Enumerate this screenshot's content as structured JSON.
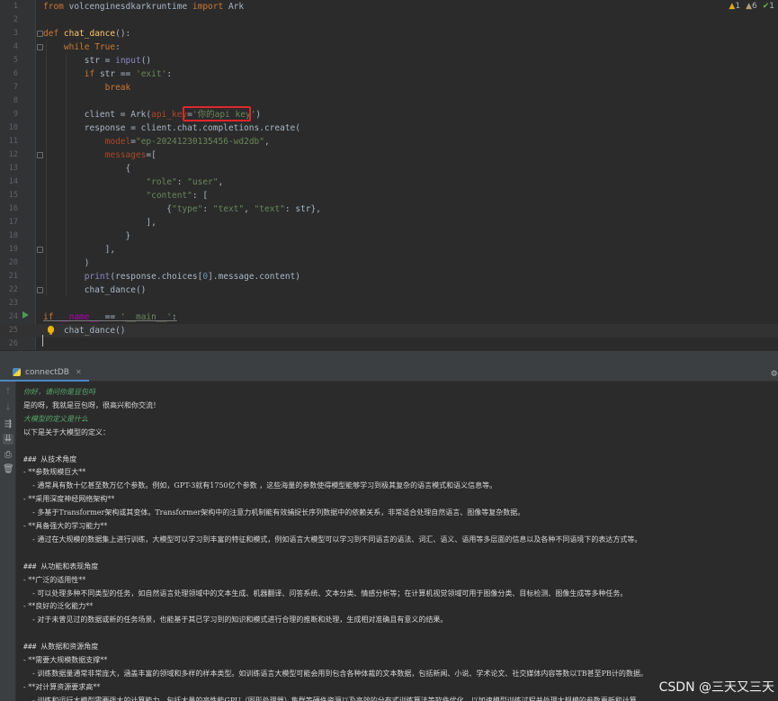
{
  "editor": {
    "inspections": {
      "warnings": "1",
      "weak_warnings": "6",
      "ok": "1"
    },
    "lines": [
      {
        "n": "1",
        "tokens": [
          [
            "kw",
            "from "
          ],
          [
            "plain",
            "volcenginesdkarkruntime "
          ],
          [
            "kw",
            "import "
          ],
          [
            "plain",
            "Ark"
          ]
        ]
      },
      {
        "n": "2",
        "tokens": []
      },
      {
        "n": "3",
        "tokens": [
          [
            "kw",
            "def "
          ],
          [
            "fn",
            "chat_dance"
          ],
          [
            "plain",
            "():"
          ]
        ]
      },
      {
        "n": "4",
        "tokens": [
          [
            "plain",
            "    "
          ],
          [
            "kw",
            "while "
          ],
          [
            "kw",
            "True"
          ],
          [
            "plain",
            ":"
          ]
        ]
      },
      {
        "n": "5",
        "tokens": [
          [
            "plain",
            "        "
          ],
          [
            "plain",
            "str = "
          ],
          [
            "builtin",
            "input"
          ],
          [
            "plain",
            "()"
          ]
        ]
      },
      {
        "n": "6",
        "tokens": [
          [
            "plain",
            "        "
          ],
          [
            "kw",
            "if "
          ],
          [
            "plain",
            "str == "
          ],
          [
            "str",
            "'exit'"
          ],
          [
            "plain",
            ":"
          ]
        ]
      },
      {
        "n": "7",
        "tokens": [
          [
            "plain",
            "            "
          ],
          [
            "kw",
            "break"
          ]
        ]
      },
      {
        "n": "8",
        "tokens": []
      },
      {
        "n": "9",
        "tokens": [
          [
            "plain",
            "        client = Ark("
          ],
          [
            "param",
            "api_key"
          ],
          [
            "plain",
            "="
          ],
          [
            "str",
            "'你的api key'"
          ],
          [
            "plain",
            ")"
          ]
        ]
      },
      {
        "n": "10",
        "tokens": [
          [
            "plain",
            "        response = client.chat.completions.create("
          ]
        ]
      },
      {
        "n": "11",
        "tokens": [
          [
            "plain",
            "            "
          ],
          [
            "param",
            "model"
          ],
          [
            "plain",
            "="
          ],
          [
            "str",
            "\"ep-20241230135456-wd2db\""
          ],
          [
            "plain",
            ","
          ]
        ]
      },
      {
        "n": "12",
        "tokens": [
          [
            "plain",
            "            "
          ],
          [
            "param",
            "messages"
          ],
          [
            "plain",
            "=["
          ]
        ]
      },
      {
        "n": "13",
        "tokens": [
          [
            "plain",
            "                {"
          ]
        ]
      },
      {
        "n": "14",
        "tokens": [
          [
            "plain",
            "                    "
          ],
          [
            "str",
            "\"role\""
          ],
          [
            "plain",
            ": "
          ],
          [
            "str",
            "\"user\""
          ],
          [
            "plain",
            ","
          ]
        ]
      },
      {
        "n": "15",
        "tokens": [
          [
            "plain",
            "                    "
          ],
          [
            "str",
            "\"content\""
          ],
          [
            "plain",
            ": ["
          ]
        ]
      },
      {
        "n": "16",
        "tokens": [
          [
            "plain",
            "                        {"
          ],
          [
            "str",
            "\"type\""
          ],
          [
            "plain",
            ": "
          ],
          [
            "str",
            "\"text\""
          ],
          [
            "plain",
            ", "
          ],
          [
            "str",
            "\"text\""
          ],
          [
            "plain",
            ": str},"
          ]
        ]
      },
      {
        "n": "17",
        "tokens": [
          [
            "plain",
            "                    ],"
          ]
        ]
      },
      {
        "n": "18",
        "tokens": [
          [
            "plain",
            "                }"
          ]
        ]
      },
      {
        "n": "19",
        "tokens": [
          [
            "plain",
            "            ],"
          ]
        ]
      },
      {
        "n": "20",
        "tokens": [
          [
            "plain",
            "        )"
          ]
        ]
      },
      {
        "n": "21",
        "tokens": [
          [
            "plain",
            "        "
          ],
          [
            "builtin",
            "print"
          ],
          [
            "plain",
            "(response.choices["
          ],
          [
            "num",
            "0"
          ],
          [
            "plain",
            "].message.content)"
          ]
        ]
      },
      {
        "n": "22",
        "tokens": [
          [
            "plain",
            "        chat_dance()"
          ]
        ]
      },
      {
        "n": "23",
        "tokens": []
      },
      {
        "n": "24",
        "tokens": [
          [
            "kw",
            "if "
          ],
          [
            "dunder",
            "__name__"
          ],
          [
            "plain",
            " == "
          ],
          [
            "str",
            "'__main__'"
          ],
          [
            "plain",
            ":"
          ]
        ]
      },
      {
        "n": "25",
        "tokens": [
          [
            "plain",
            "    chat_dance()"
          ]
        ]
      },
      {
        "n": "26",
        "tokens": []
      }
    ]
  },
  "run_panel": {
    "tab_label": "connectDB",
    "console_lines": [
      {
        "style": "green",
        "text": "你好，请问你是豆包吗"
      },
      {
        "style": "normal",
        "text": "是的呀，我就是豆包呀，很高兴和你交流！"
      },
      {
        "style": "green",
        "text": "大模型的定义是什么"
      },
      {
        "style": "normal",
        "text": "以下是关于大模型的定义："
      },
      {
        "style": "normal",
        "text": ""
      },
      {
        "style": "heading",
        "text": "### 从技术角度"
      },
      {
        "style": "normal",
        "text": "- **参数规模巨大**"
      },
      {
        "style": "normal",
        "text": "    - 通常具有数十亿甚至数万亿个参数。例如，GPT-3就有1750亿个参数 ，这些海量的参数使得模型能够学习到极其复杂的语言模式和语义信息等。"
      },
      {
        "style": "normal",
        "text": "- **采用深度神经网络架构**"
      },
      {
        "style": "normal",
        "text": "    - 多基于Transformer架构或其变体。Transformer架构中的注意力机制能有效捕捉长序列数据中的依赖关系，非常适合处理自然语言、图像等复杂数据。"
      },
      {
        "style": "normal",
        "text": "- **具备强大的学习能力**"
      },
      {
        "style": "normal",
        "text": "    - 通过在大规模的数据集上进行训练，大模型可以学习到丰富的特征和模式，例如语言大模型可以学习到不同语言的语法、词汇、语义、语用等多层面的信息以及各种不同语境下的表达方式等。"
      },
      {
        "style": "normal",
        "text": ""
      },
      {
        "style": "heading",
        "text": "### 从功能和表现角度"
      },
      {
        "style": "normal",
        "text": "- **广泛的适用性**"
      },
      {
        "style": "normal",
        "text": "    - 可以处理多种不同类型的任务，如自然语言处理领域中的文本生成、机器翻译、问答系统、文本分类、情感分析等；在计算机视觉领域可用于图像分类、目标检测、图像生成等多种任务。"
      },
      {
        "style": "normal",
        "text": "- **良好的泛化能力**"
      },
      {
        "style": "normal",
        "text": "    - 对于未曾见过的数据或新的任务场景，也能基于其已学习到的知识和模式进行合理的推断和处理，生成相对准确且有意义的结果。"
      },
      {
        "style": "normal",
        "text": ""
      },
      {
        "style": "heading",
        "text": "### 从数据和资源角度"
      },
      {
        "style": "normal",
        "text": "- **需要大规模数据支撑**"
      },
      {
        "style": "normal",
        "text": "    - 训练数据量通常非常庞大，涵盖丰富的领域和多样的样本类型。如训练语言大模型可能会用到包含各种体裁的文本数据，包括新闻、小说、学术论文、社交媒体内容等数以TB甚至PB计的数据。"
      },
      {
        "style": "normal",
        "text": "- **对计算资源要求高**"
      },
      {
        "style": "normal",
        "text": "    - 训练和运行大模型需要强大的计算能力，包括大量的高性能GPU（图形处理器）集群等硬件资源以及高效的分布式训练算法等软件优化，以加速模型训练过程并处理大规模的参数更新和计算。"
      }
    ]
  },
  "watermark": "CSDN @三天又三天"
}
